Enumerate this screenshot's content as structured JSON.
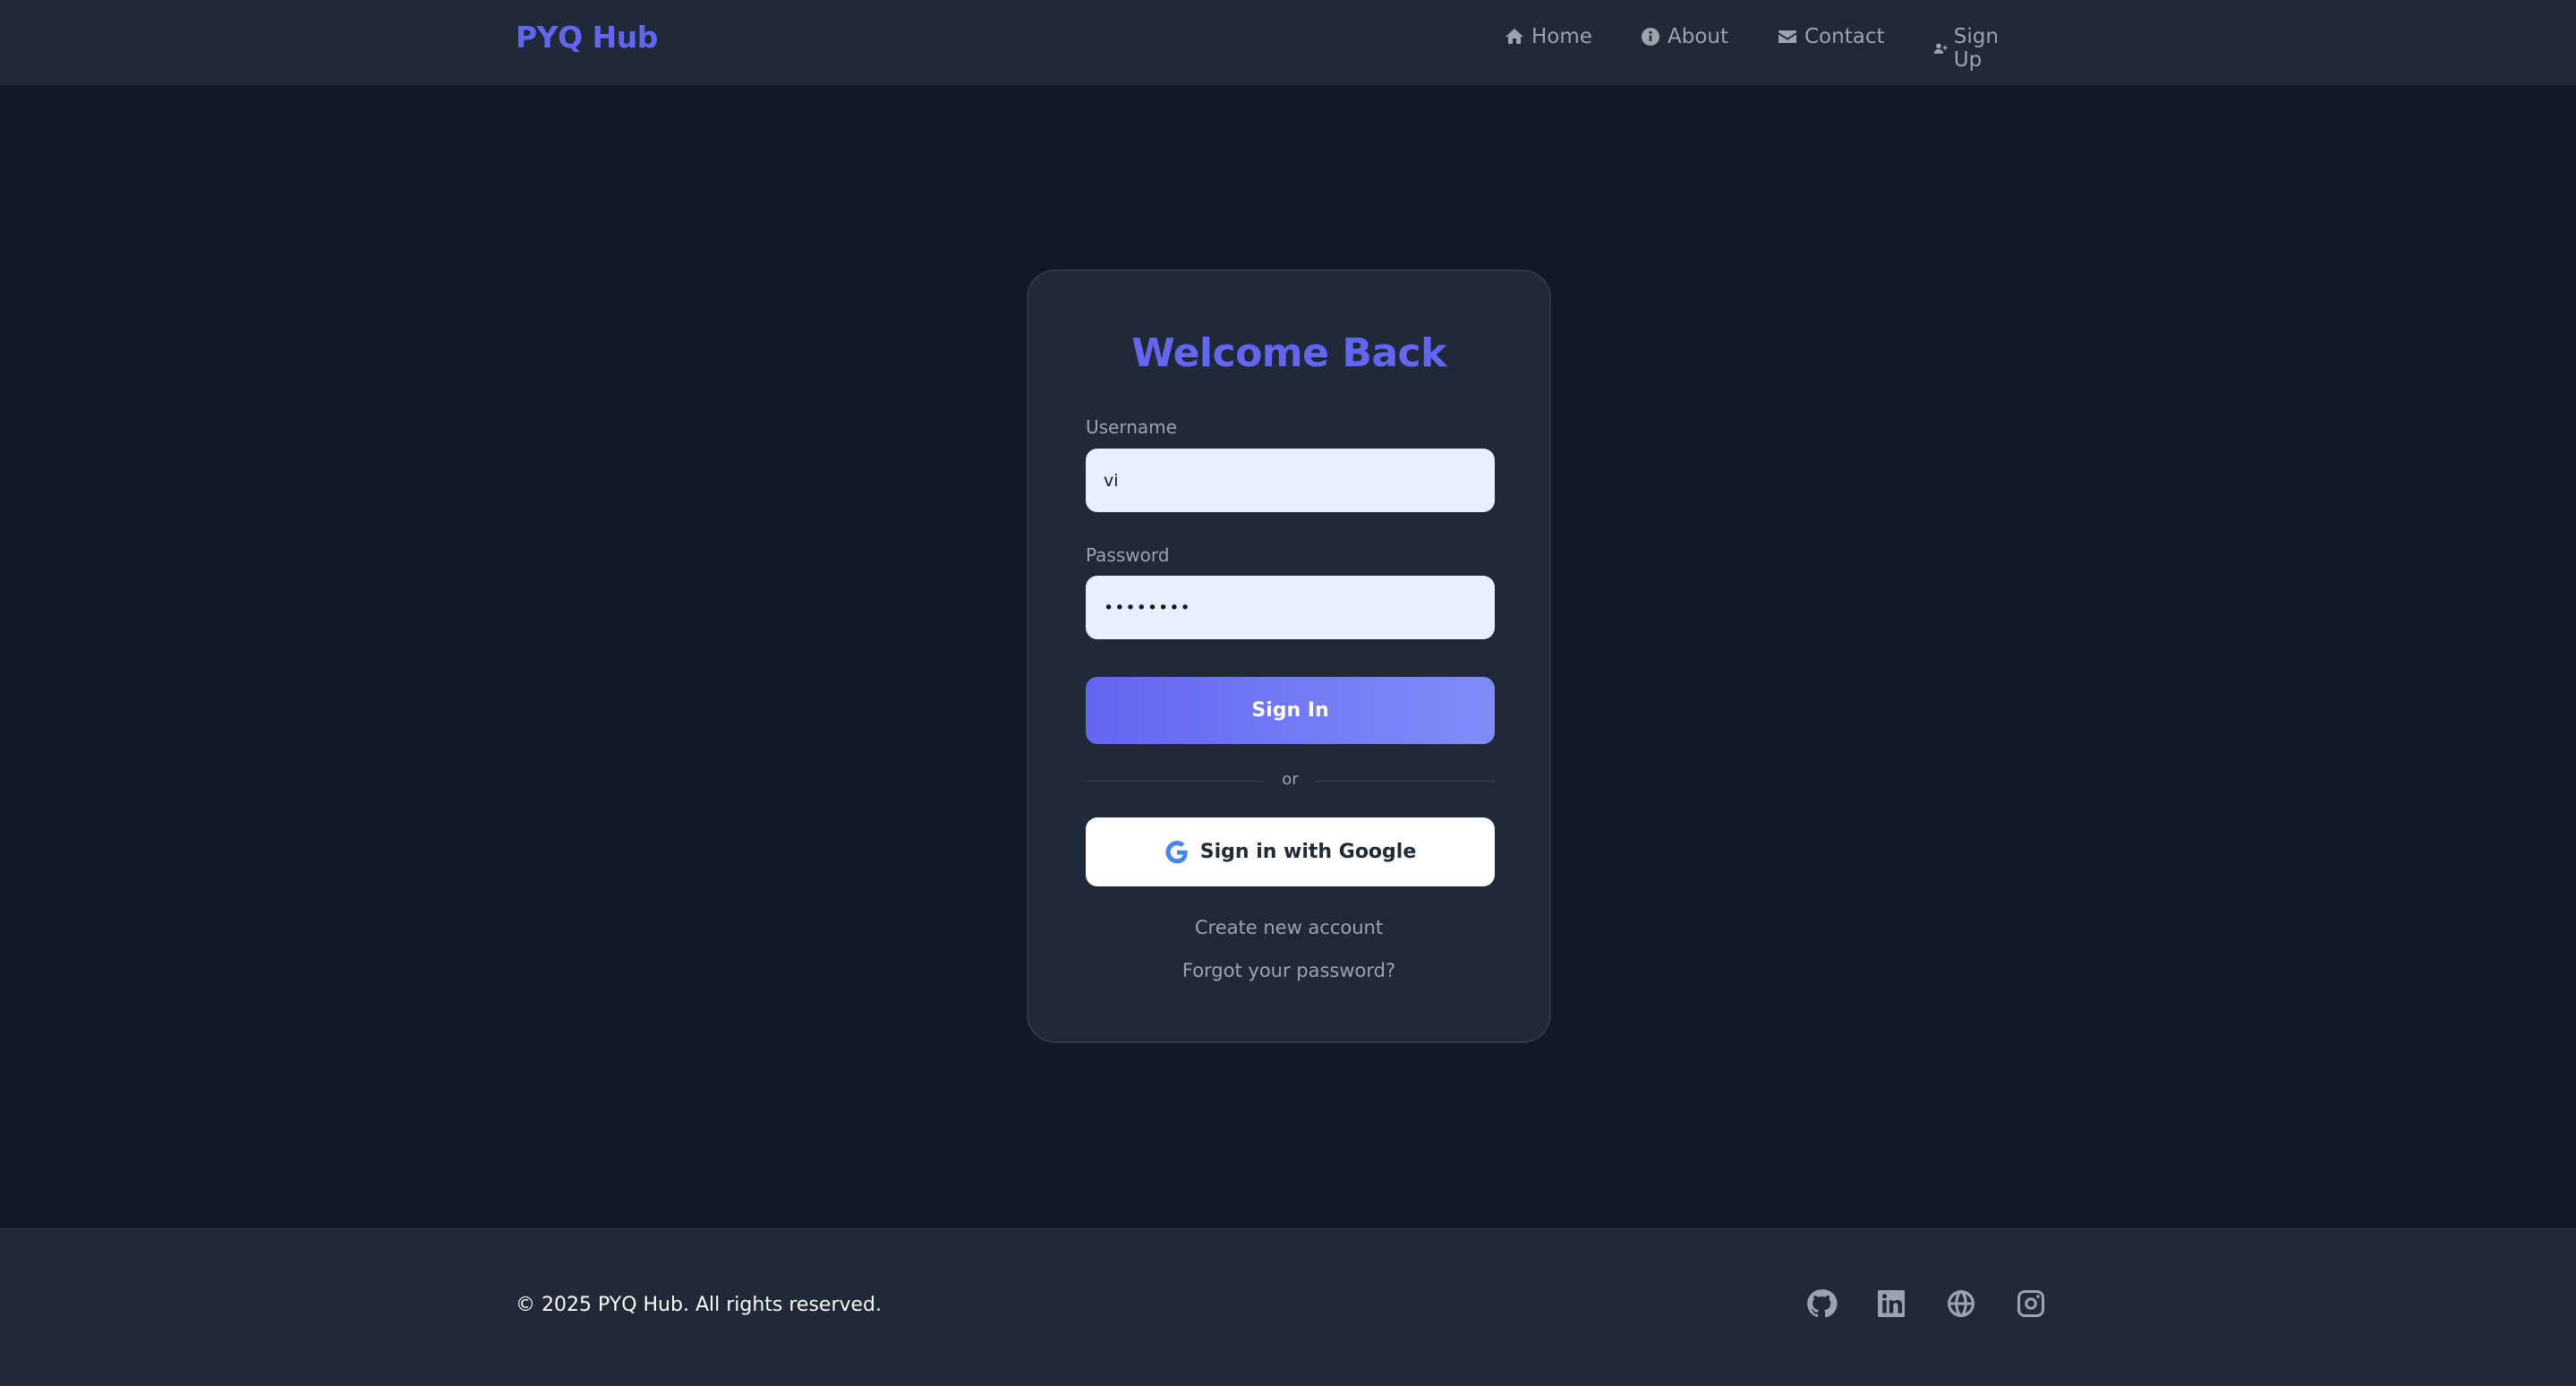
{
  "nav": {
    "brand": "PYQ Hub",
    "links": [
      {
        "label": "Home",
        "icon": "home-icon"
      },
      {
        "label": "About",
        "icon": "info-icon"
      },
      {
        "label": "Contact",
        "icon": "envelope-icon"
      },
      {
        "label": "Sign Up",
        "icon": "user-plus-icon"
      }
    ]
  },
  "login": {
    "title": "Welcome Back",
    "username_label": "Username",
    "username_value": "vi",
    "password_label": "Password",
    "password_value": "••••••••",
    "signin_label": "Sign In",
    "divider_text": "or",
    "google_label": "Sign in with Google",
    "create_account": "Create new account",
    "forgot_password": "Forgot your password?"
  },
  "footer": {
    "copyright": "© 2025 PYQ Hub. All rights reserved.",
    "social": [
      "github-icon",
      "linkedin-icon",
      "globe-icon",
      "instagram-icon"
    ]
  },
  "colors": {
    "accent": "#6366f1",
    "background": "#111827",
    "surface": "#1f2937"
  }
}
